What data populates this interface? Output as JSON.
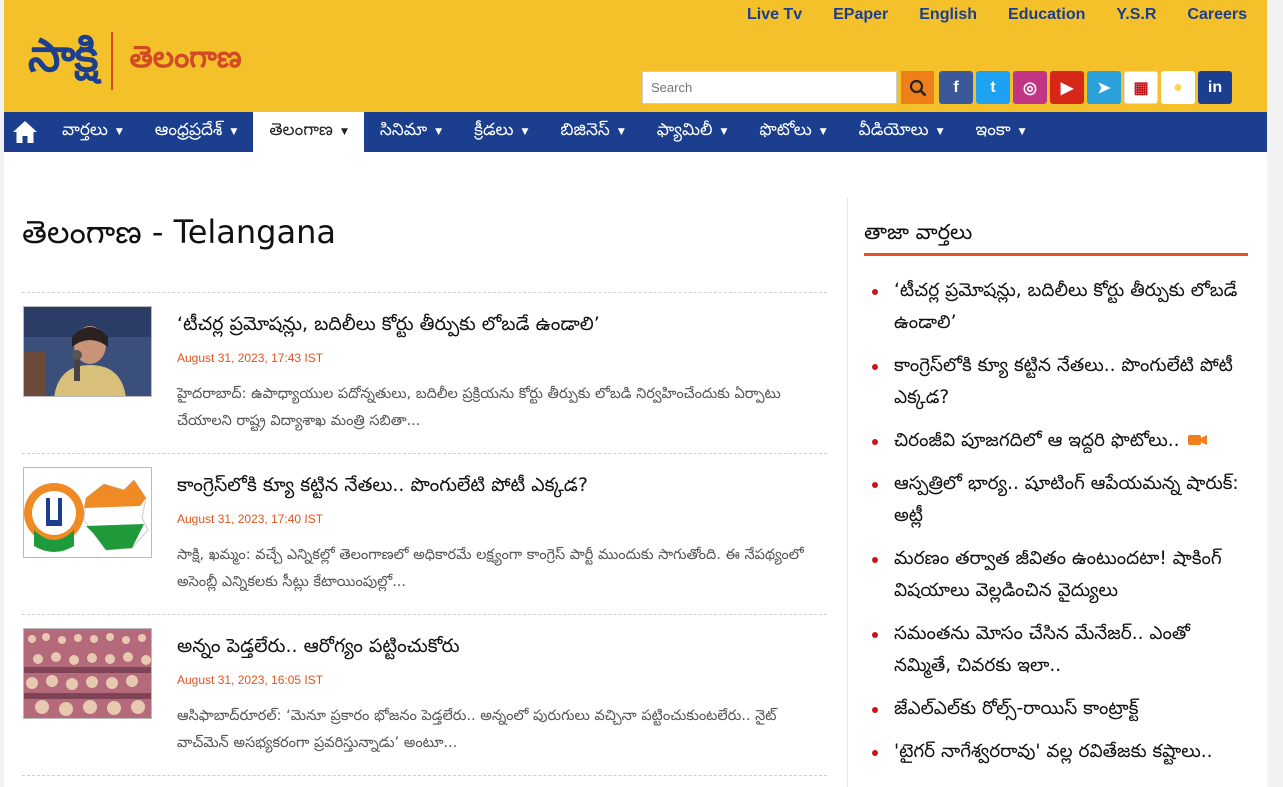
{
  "header": {
    "logo_main": "సాక్షి",
    "logo_sub": "తెలంగాణ",
    "top_links": [
      "Live Tv",
      "EPaper",
      "English",
      "Education",
      "Y.S.R",
      "Careers"
    ],
    "search_placeholder": "Search",
    "social": [
      {
        "icon": "facebook-icon",
        "glyph": "f",
        "color": "#3b5998"
      },
      {
        "icon": "twitter-icon",
        "glyph": "t",
        "color": "#1da1f2"
      },
      {
        "icon": "instagram-icon",
        "glyph": "◎",
        "color": "#c13584"
      },
      {
        "icon": "youtube-icon",
        "glyph": "▶",
        "color": "#d62718"
      },
      {
        "icon": "telegram-icon",
        "glyph": "➤",
        "color": "#2aa1da"
      },
      {
        "icon": "calendar-icon",
        "glyph": "▦",
        "color": "#ffffff"
      },
      {
        "icon": "koo-icon",
        "glyph": "●",
        "color": "#f5c12b"
      },
      {
        "icon": "linkedin-icon",
        "glyph": "in",
        "color": "#1b3f8e"
      }
    ]
  },
  "nav": {
    "items": [
      "వార్తలు",
      "ఆంధ్రప్రదేశ్",
      "తెలంగాణ",
      "సినిమా",
      "క్రీడలు",
      "బిజినెస్",
      "ఫ్యామిలీ",
      "ఫొటోలు",
      "వీడియోలు",
      "ఇంకా"
    ],
    "active_index": 2
  },
  "main": {
    "title": "తెలంగాణ - Telangana",
    "articles": [
      {
        "title": "‘టీచర్ల ప్రమోషన్లు, బదిలీలు కోర్టు తీర్పుకు లోబడే ఉండాలి’",
        "date": "August 31, 2023, 17:43 IST",
        "summary": "హైదరాబాద్: ఉపాధ్యాయుల పదోన్నతులు, బదిలీల ప్రక్రియను కోర్టు తీర్పుకు లోబడి నిర్వహించేందుకు ఏర్పాటు చేయాలని రాష్ట్ర విద్యాశాఖ మంత్రి సబితా..."
      },
      {
        "title": "కాంగ్రెస్‌లోకి క్యూ కట్టిన నేతలు.. పొంగులేటి పోటీ ఎక్కడ?",
        "date": "August 31, 2023, 17:40 IST",
        "summary": "సాక్షి, ఖమ్మం: వచ్చే ఎన్నికల్లో తెలంగాణలో అధికారమే లక్ష్యంగా కాంగ్రెస్‌ పార్టీ ముందుకు సాగుతోంది. ఈ నేపథ్యంలో అసెంబ్లీ ఎన్నికలకు సీట్లు కేటాయింపుల్లో..."
      },
      {
        "title": "అన్నం పెడ్తలేరు.. ఆరోగ్యం పట్టించుకోరు",
        "date": "August 31, 2023, 16:05 IST",
        "summary": "ఆసిఫాబాద్‌రూరల్‌: ‘మెనూ ప్రకారం భోజనం పెడ్తలేరు.. అన్నంలో పురుగులు వచ్చినా పట్టించుకుంటలేరు.. నైట్‌ వాచ్‌మెన్‌ అసభ్యకరంగా ప్రవరిస్తున్నాడు’ అంటూ..."
      }
    ]
  },
  "sidebar": {
    "title": "తాజా వార్తలు",
    "items": [
      "‘టీచర్ల ప్రమోషన్లు, బదిలీలు కోర్టు తీర్పుకు లోబడే ఉండాలి’",
      "కాంగ్రెస్‌లోకి క్యూ కట్టిన నేతలు.. పొంగులేటి పోటీ ఎక్కడ?",
      "చిరంజీవి పూజగదిలో ఆ ఇద్దరి ఫొటోలు..",
      "ఆస్పత్రిలో భార్య.. షూటింగ్ ఆపేయమన్న షారుక్: అట్లీ",
      "మరణం తర్వాత జీవితం ఉంటుందటా! షాకింగ్ విషయాలు వెల్లడించిన వైద్యులు",
      "సమంతను మోసం చేసిన మేనేజర్.. ఎంతో నమ్మితే, చివరకు ఇలా..",
      "జేఎల్‌ఎల్‌కు రోల్స్‌-రాయిస్‌ కాంట్రాక్ట్‌",
      "'టైగర్ నాగేశ్వరరావు' వల్ల రవితేజకు కష్టాలు.."
    ],
    "video_item_index": 2
  },
  "colors": {
    "header_bg": "#f5c12b",
    "nav_bg": "#1b3f8e",
    "accent": "#e2531d",
    "bullet": "#c9151b"
  }
}
